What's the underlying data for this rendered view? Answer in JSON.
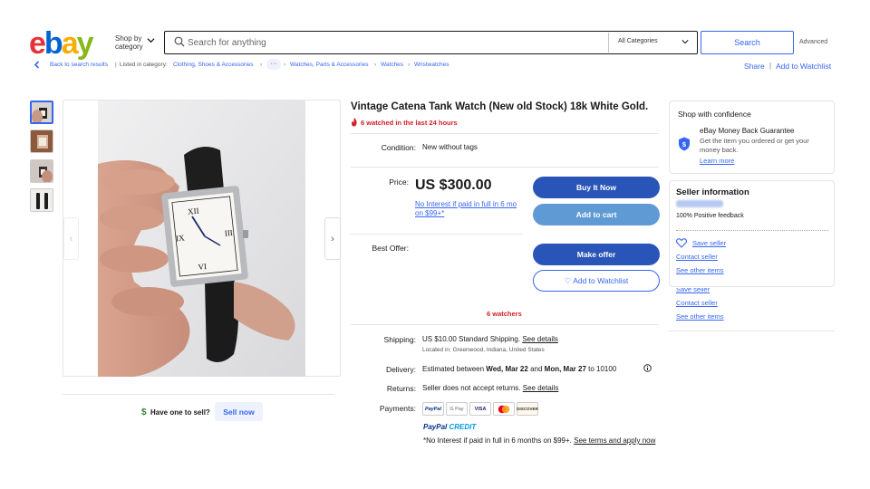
{
  "header": {
    "logo": {
      "e": "e",
      "b": "b",
      "a": "a",
      "y": "y"
    },
    "shop_by": "Shop by",
    "shop_by_2": "category",
    "search_placeholder": "Search for anything",
    "category_select": "All Categories",
    "search_button": "Search",
    "advanced": "Advanced"
  },
  "breadcrumb": {
    "back": "Back to search results",
    "listed_in": "Listed in category:",
    "items": [
      "Clothing, Shoes & Accessories",
      "Watches, Parts & Accessories",
      "Watches",
      "Wristwatches"
    ],
    "dots": "···",
    "sep": "›",
    "share": "Share",
    "divider": "|",
    "add_watchlist": "Add to Watchlist"
  },
  "gallery": {
    "prev": "‹",
    "next": "›",
    "sell_dollar": "$",
    "sell_question": "Have one to sell?",
    "sell_now": "Sell now"
  },
  "listing": {
    "title": "Vintage Catena Tank Watch (New old Stock) 18k White Gold.",
    "watched_recent": "6 watched in the last 24 hours",
    "condition_label": "Condition:",
    "condition_value": "New without tags",
    "price_label": "Price:",
    "price": "US $300.00",
    "no_interest": "No Interest if paid in full in 6 mo on $99+*",
    "buy_now": "Buy It Now",
    "add_to_cart": "Add to cart",
    "best_offer_label": "Best Offer:",
    "make_offer": "Make offer",
    "add_to_watchlist": "♡ Add to Watchlist",
    "watchers": "6 watchers",
    "shipping_label": "Shipping:",
    "shipping_value": "US $10.00 Standard Shipping.",
    "see_details": "See details",
    "located_in": "Located in: Greenwood, Indiana, United States",
    "delivery_label": "Delivery:",
    "delivery_pre": "Estimated between",
    "delivery_date1": "Wed, Mar 22",
    "delivery_and": "and",
    "delivery_date2": "Mon, Mar 27",
    "delivery_post": "to 10100",
    "returns_label": "Returns:",
    "returns_value": "Seller does not accept returns.",
    "returns_details": "See details",
    "payments_label": "Payments:",
    "payment_methods": [
      "PayPal",
      "G Pay",
      "VISA",
      "MC",
      "DISCOVER"
    ],
    "paypal_credit_1": "PayPal",
    "paypal_credit_2": "CREDIT",
    "pay_note": "*No Interest if paid in full in 6 months on $99+.",
    "pay_terms": "See terms and apply now"
  },
  "confidence": {
    "title": "Shop with confidence",
    "mbg_title": "eBay Money Back Guarantee",
    "mbg_text": "Get the item you ordered or get your money back.",
    "learn_more": "Learn more"
  },
  "seller": {
    "title": "Seller information",
    "feedback": "100% Positive feedback",
    "save_seller": "Save seller",
    "contact_seller": "Contact seller",
    "see_other": "See other items",
    "ghost_save": "Save seller",
    "ghost_contact": "Contact seller",
    "ghost_other": "See other items"
  },
  "colors": {
    "accent": "#3665f3",
    "button_primary": "#2a55b8",
    "button_secondary": "#5f9ad4",
    "alert": "#d61f26"
  },
  "icons": [
    "chevron-down-icon",
    "search-icon",
    "back-chevron-icon",
    "fire-icon",
    "shield-icon",
    "heart-icon",
    "info-icon"
  ]
}
